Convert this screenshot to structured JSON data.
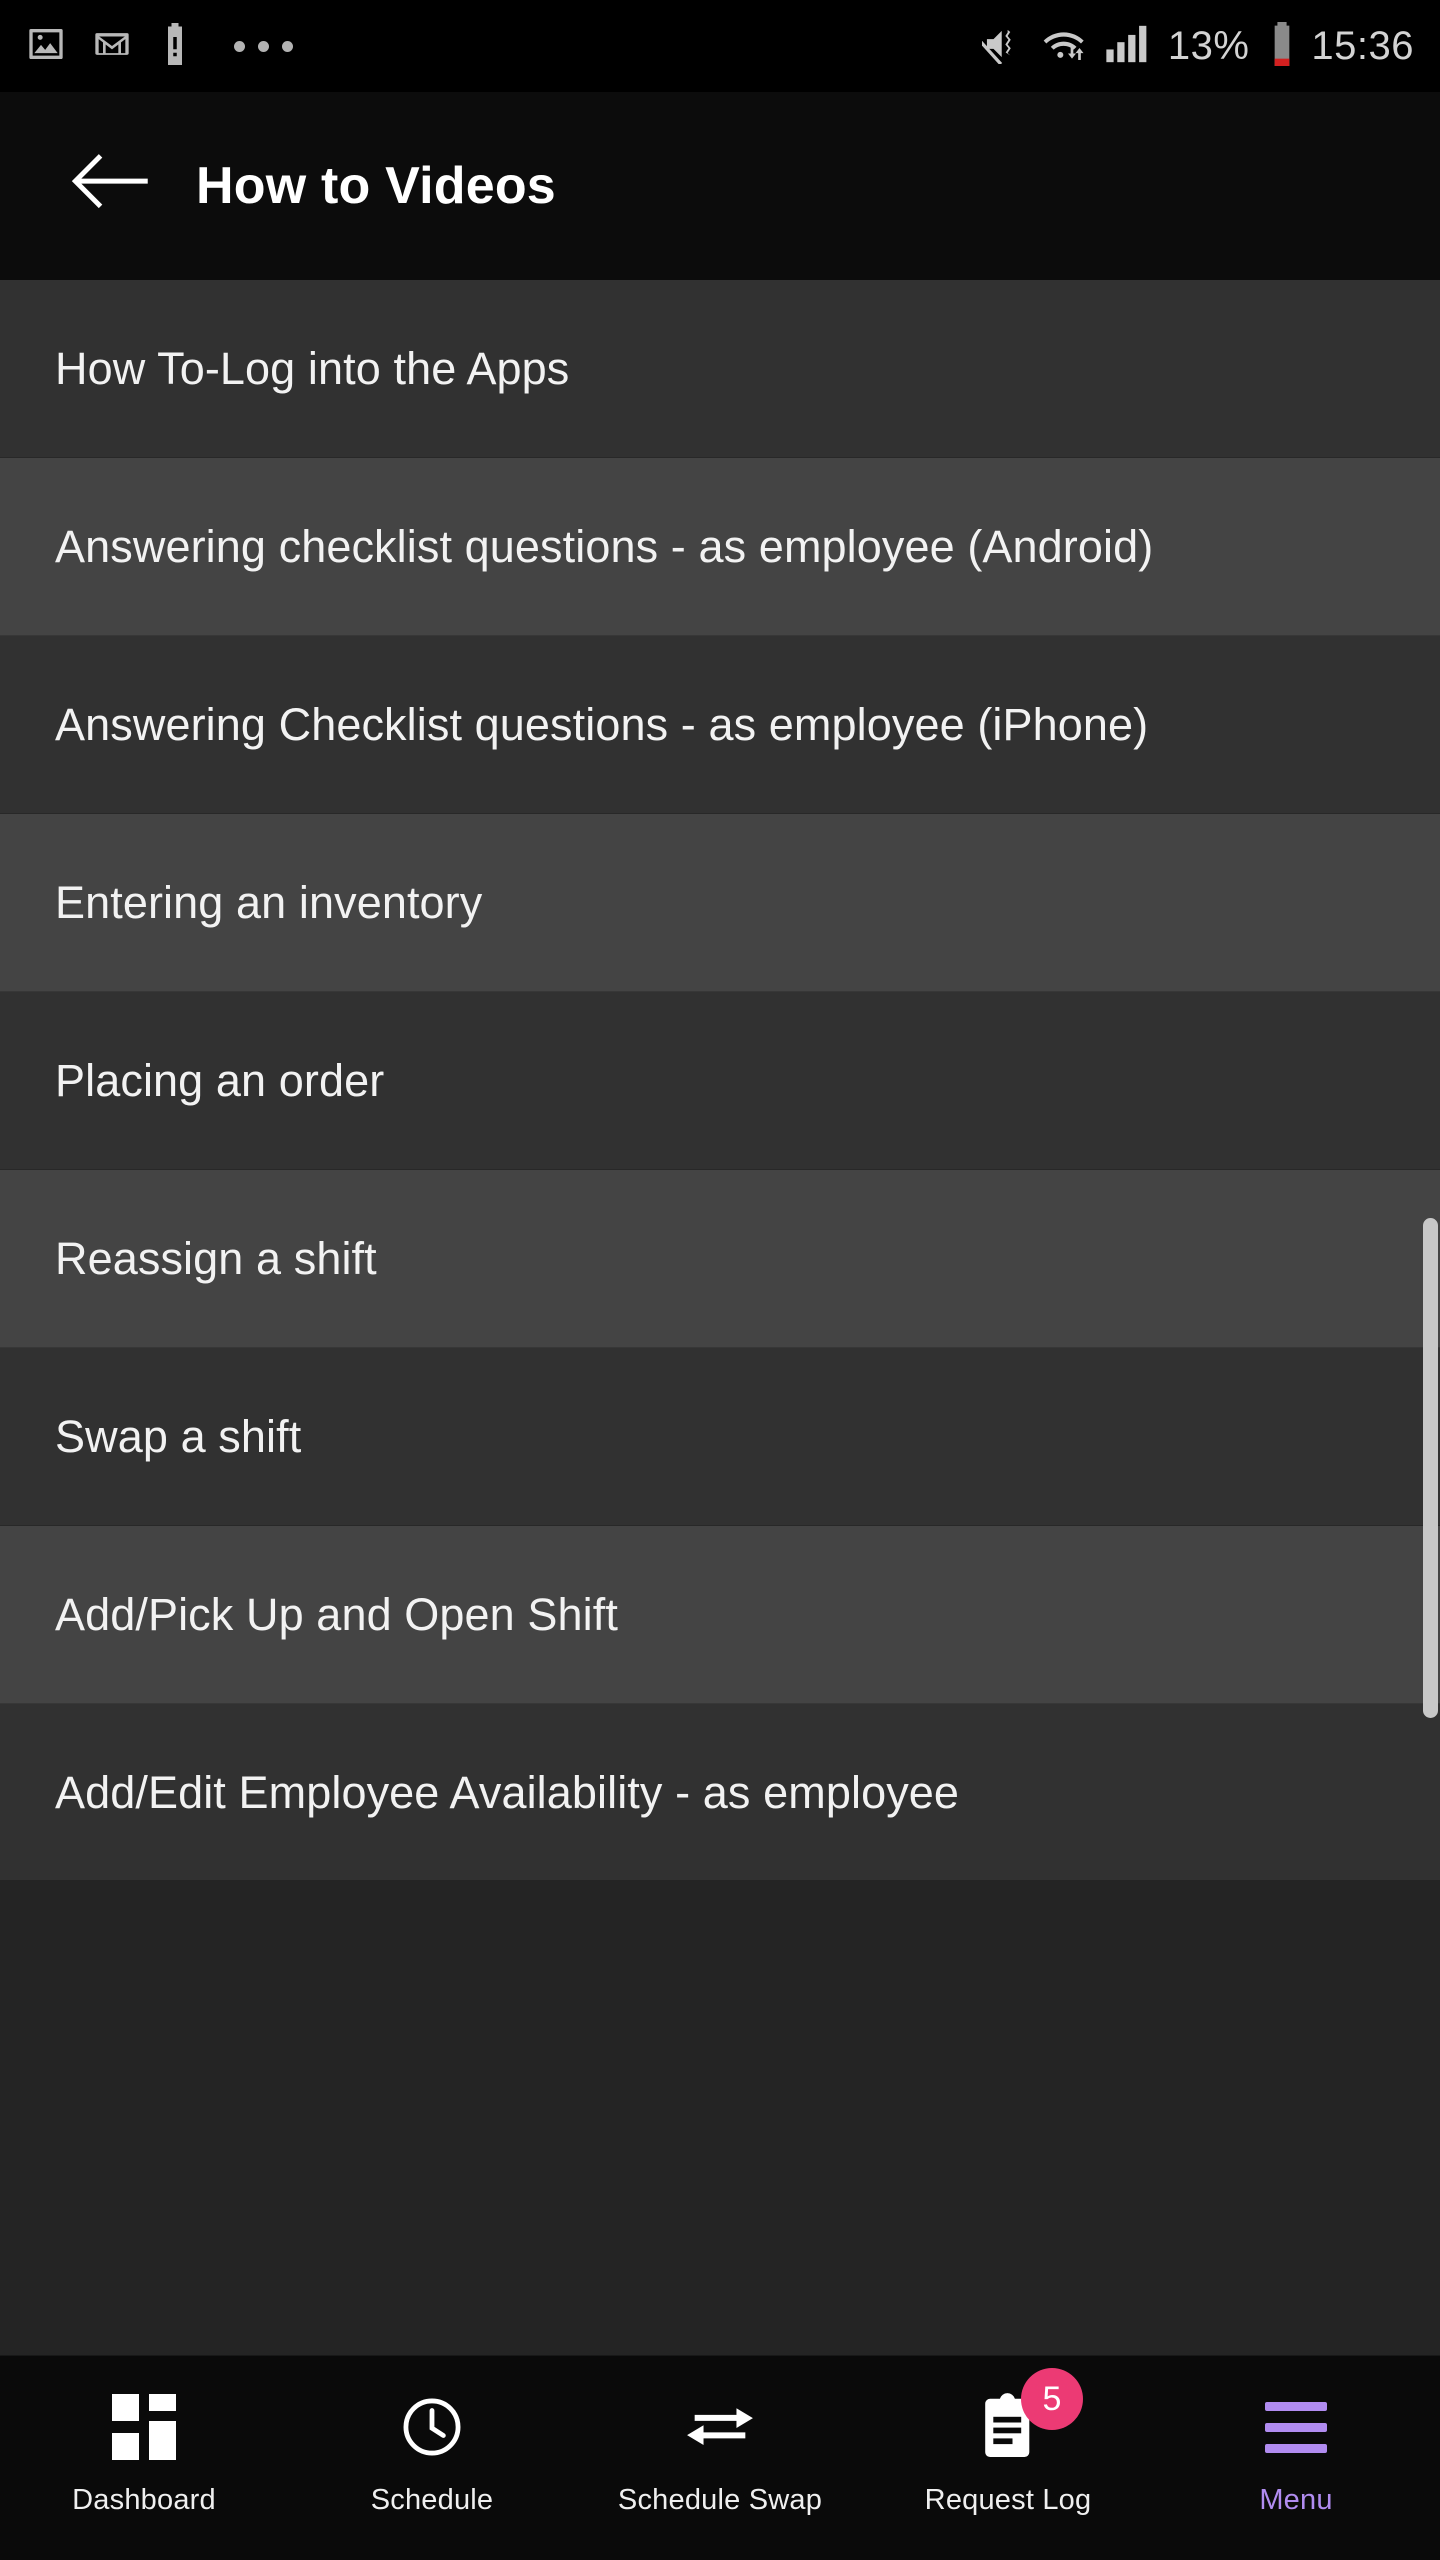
{
  "status_bar": {
    "left_icons": [
      "photo-icon",
      "gmail-icon",
      "battery-alert-icon",
      "more-notifications-icon"
    ],
    "right_icons": [
      "mute-vibrate-icon",
      "wifi-icon",
      "cellular-signal-icon",
      "battery-icon"
    ],
    "battery_percent": "13%",
    "time": "15:36"
  },
  "app_bar": {
    "back_label": "back-arrow",
    "title": "How to Videos"
  },
  "list": {
    "items": [
      {
        "label": "How To-Log into the Apps"
      },
      {
        "label": "Answering checklist questions - as employee (Android)"
      },
      {
        "label": "Answering Checklist questions - as employee (iPhone)"
      },
      {
        "label": "Entering an inventory"
      },
      {
        "label": "Placing an order"
      },
      {
        "label": "Reassign a shift"
      },
      {
        "label": "Swap a shift"
      },
      {
        "label": "Add/Pick Up and Open Shift"
      },
      {
        "label": "Add/Edit Employee Availability - as employee"
      }
    ]
  },
  "bottom_nav": {
    "items": [
      {
        "label": "Dashboard",
        "icon": "dashboard-grid-icon",
        "active": false,
        "badge": ""
      },
      {
        "label": "Schedule",
        "icon": "clock-icon",
        "active": false,
        "badge": ""
      },
      {
        "label": "Schedule Swap",
        "icon": "swap-arrows-icon",
        "active": false,
        "badge": ""
      },
      {
        "label": "Request Log",
        "icon": "clipboard-icon",
        "active": false,
        "badge": "5"
      },
      {
        "label": "Menu",
        "icon": "hamburger-menu-icon",
        "active": true,
        "badge": ""
      }
    ]
  },
  "colors": {
    "accent_purple": "#b18cf0",
    "badge_pink": "#ec3a74",
    "row_odd": "#313131",
    "row_even": "#444444",
    "app_bar_bg": "#0c0c0c",
    "nav_bg": "#0a0a0a"
  }
}
